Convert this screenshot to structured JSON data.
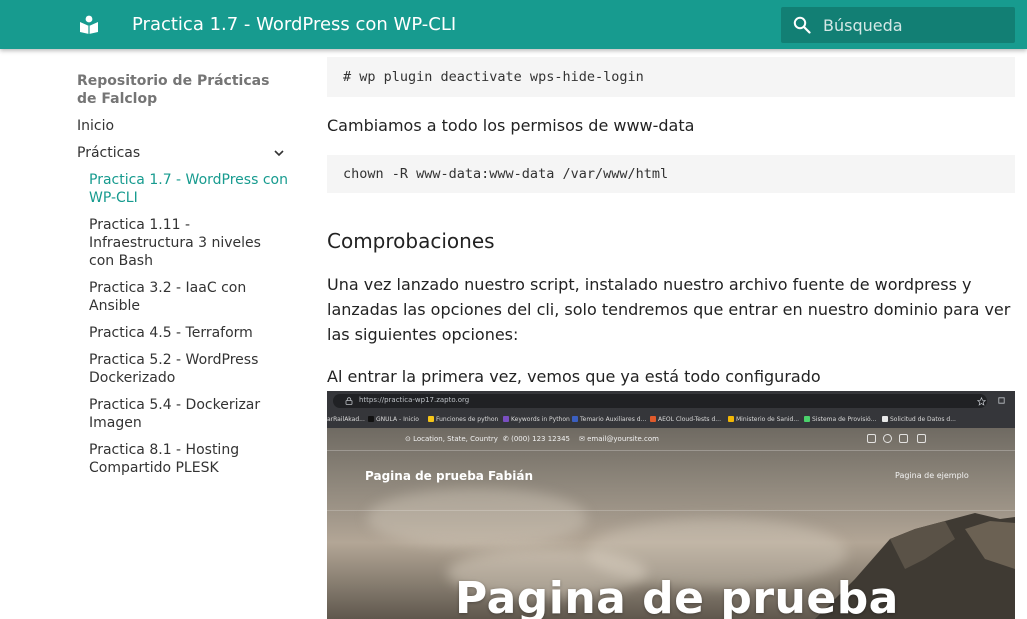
{
  "header": {
    "title": "Practica 1.7 - WordPress con WP-CLI",
    "search_placeholder": "Búsqueda",
    "color": "#179b8f"
  },
  "sidebar": {
    "repo_title": "Repositorio de Prácticas de Falclop",
    "items": [
      {
        "label": "Inicio"
      },
      {
        "label": "Prácticas",
        "expanded": true
      }
    ],
    "practicas": [
      {
        "label": "Practica 1.7 - WordPress con WP-CLI",
        "active": true
      },
      {
        "label": "Practica 1.11 - Infraestructura 3 niveles con Bash"
      },
      {
        "label": "Practica 3.2 - IaaC con Ansible"
      },
      {
        "label": "Practica 4.5 - Terraform"
      },
      {
        "label": "Practica 5.2 - WordPress Dockerizado"
      },
      {
        "label": "Practica 5.4 - Dockerizar Imagen"
      },
      {
        "label": "Practica 8.1 - Hosting Compartido PLESK"
      }
    ]
  },
  "content": {
    "code1": "# wp plugin deactivate wps-hide-login",
    "p1": "Cambiamos a todo los permisos de www-data",
    "code2": "chown -R www-data:www-data /var/www/html",
    "heading": "Comprobaciones",
    "p2": "Una vez lanzado nuestro script, instalado nuestro archivo fuente de wordpress y lanzadas las opciones del cli, solo tendremos que entrar en nuestro dominio para ver las siguientes opciones:",
    "p3": "Al entrar la primera vez, vemos que ya está todo configurado"
  },
  "screenshot": {
    "url": "https://practica-wp17.zapto.org",
    "bookmarks": [
      "arRailAkad...",
      "GNULA - Inicio",
      "Funciones de python",
      "Keywords in Python",
      "Temario Auxiliares d...",
      "AEOL Cloud-Tests d...",
      "Ministerio de Sanid...",
      "Sistema de Provisió...",
      "Solicitud de Datos d..."
    ],
    "location": "Location, State, Country",
    "phone": "(000) 123 12345",
    "email": "email@yoursite.com",
    "site_name": "Pagina de prueba Fabián",
    "menu_item": "Pagina de ejemplo",
    "hero_title": "Pagina de prueba"
  }
}
